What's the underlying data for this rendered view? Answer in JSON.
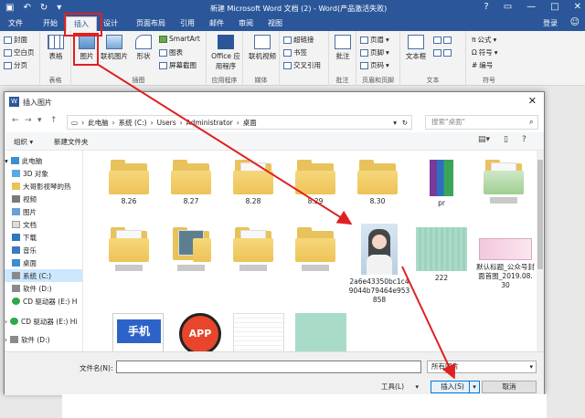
{
  "titlebar": {
    "title": "新建 Microsoft Word 文档 (2) - Word(产品激活失败)",
    "help": "?",
    "minimize": "—",
    "restore": "□",
    "close": "✕"
  },
  "tabs": {
    "items": [
      "文件",
      "开始",
      "插入",
      "设计",
      "页面布局",
      "引用",
      "邮件",
      "审阅",
      "视图"
    ],
    "active": "插入",
    "login": "登录"
  },
  "ribbon": {
    "clipboard": [
      "封面",
      "空白页",
      "分页"
    ],
    "table": "表格",
    "table_group": "表格",
    "picture": "图片",
    "online_picture": "联机图片",
    "shapes": "形状",
    "smartart": "SmartArt",
    "chart": "图表",
    "screenshot": "屏幕截图",
    "illustrations_group": "插图",
    "office_apps": "Office 应用程序",
    "apps_group": "应用程序",
    "online_video": "联机视频",
    "media_group": "媒体",
    "links": [
      "超链接",
      "书签",
      "交叉引用"
    ],
    "comment": "批注",
    "comment_group": "批注",
    "header_footer": [
      "页眉",
      "页脚",
      "页码"
    ],
    "hf_group": "页眉和页脚",
    "textbox": "文本框",
    "text_group": "文本",
    "symbols": [
      "公式",
      "符号",
      "编号"
    ],
    "symbols_group": "符号"
  },
  "dialog": {
    "title": "插入图片",
    "path": [
      "此电脑",
      "系统 (C:)",
      "Users",
      "Administrator",
      "桌面"
    ],
    "search_placeholder": "搜索\"桌面\"",
    "organize": "组织 ▾",
    "new_folder": "新建文件夹",
    "nav": [
      {
        "label": "此电脑",
        "icon": "computer-icon"
      },
      {
        "label": "3D 对象",
        "icon": "cube-icon"
      },
      {
        "label": "大哥影视琴的热",
        "icon": "folder-icon"
      },
      {
        "label": "视频",
        "icon": "video-icon"
      },
      {
        "label": "图片",
        "icon": "picture-icon"
      },
      {
        "label": "文档",
        "icon": "document-icon"
      },
      {
        "label": "下载",
        "icon": "download-icon"
      },
      {
        "label": "音乐",
        "icon": "music-icon"
      },
      {
        "label": "桌面",
        "icon": "desktop-icon"
      },
      {
        "label": "系统 (C:)",
        "icon": "drive-icon"
      },
      {
        "label": "软件 (D:)",
        "icon": "drive-icon"
      },
      {
        "label": "CD 驱动器 (E:) H",
        "icon": "cd-icon"
      },
      {
        "label": "CD 驱动器 (E:) Hi",
        "icon": "cd-icon"
      },
      {
        "label": "软件 (D:)",
        "icon": "drive-icon"
      }
    ],
    "files_row1": [
      "8.26",
      "8.27",
      "8.28",
      "8.29",
      "8.30",
      "pr",
      ""
    ],
    "files_row2": [
      "",
      "",
      "",
      "",
      "2a6e43350bc1c49044b79464e953858",
      "222",
      "默认标题_公众号封面首图_2019.08.30"
    ],
    "files_row3": [
      "手机",
      "APP",
      "",
      ""
    ],
    "filename_label": "文件名(N):",
    "filename_value": "",
    "filetype": "所有图片",
    "tools": "工具(L)",
    "insert": "插入(S)",
    "cancel": "取消"
  },
  "colors": {
    "word_blue": "#2b579a",
    "highlight_red": "#e02020",
    "selection": "#cce8ff"
  }
}
